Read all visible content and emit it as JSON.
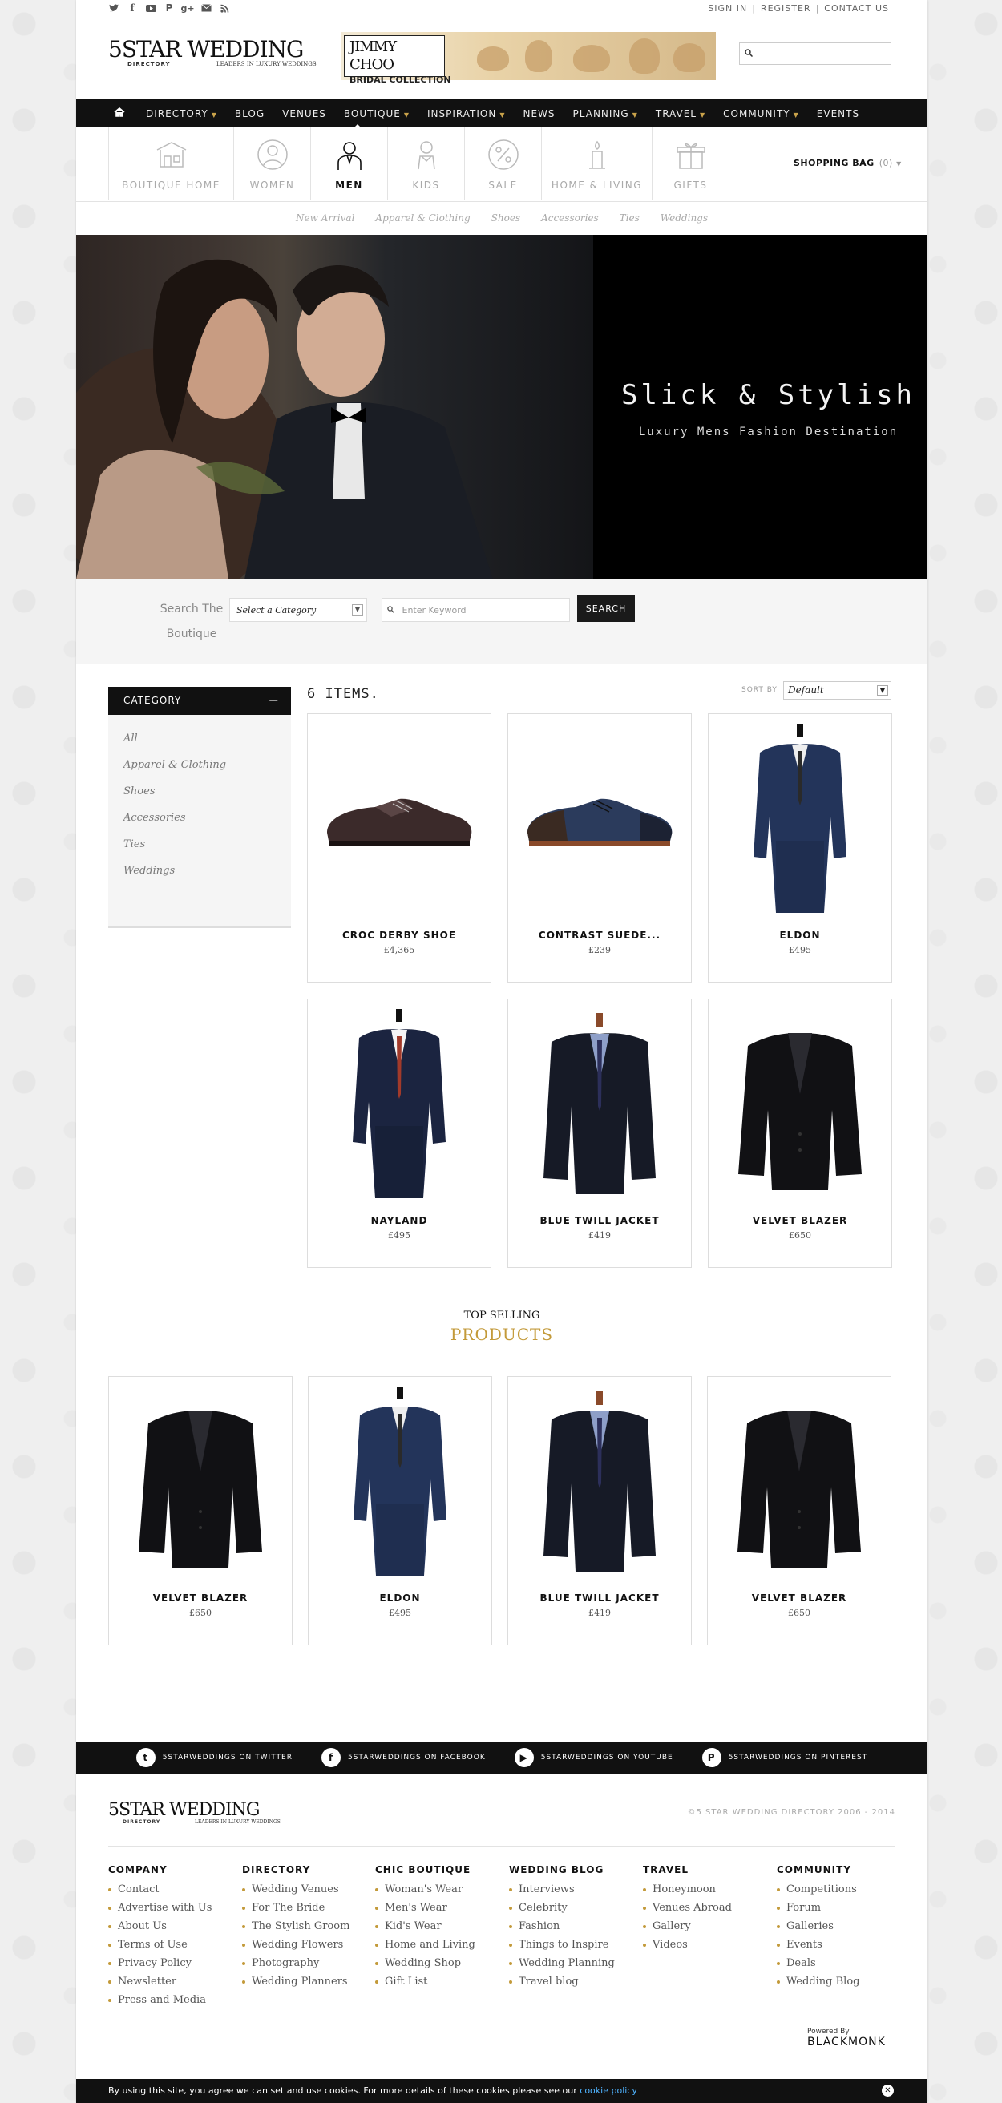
{
  "top": {
    "social_icons": [
      "twitter-icon",
      "facebook-icon",
      "youtube-icon",
      "pinterest-icon",
      "google-plus-icon",
      "email-icon",
      "rss-icon"
    ],
    "links": [
      "SIGN IN",
      "REGISTER",
      "CONTACT US"
    ]
  },
  "logo": {
    "big": "5STAR WEDDING",
    "small": "DIRECTORY",
    "tag": "LEADERS IN LUXURY WEDDINGS"
  },
  "ad": {
    "line1": "JIMMY CHOO",
    "line2": "BRIDAL COLLECTION"
  },
  "nav": {
    "items": [
      {
        "label": "DIRECTORY",
        "caret": true
      },
      {
        "label": "BLOG",
        "caret": false
      },
      {
        "label": "VENUES",
        "caret": false
      },
      {
        "label": "BOUTIQUE",
        "caret": true
      },
      {
        "label": "INSPIRATION",
        "caret": true
      },
      {
        "label": "NEWS",
        "caret": false
      },
      {
        "label": "PLANNING",
        "caret": true
      },
      {
        "label": "TRAVEL",
        "caret": true
      },
      {
        "label": "COMMUNITY",
        "caret": true
      },
      {
        "label": "EVENTS",
        "caret": false
      }
    ]
  },
  "boutique": {
    "cats": [
      "BOUTIQUE HOME",
      "WOMEN",
      "MEN",
      "KIDS",
      "SALE",
      "HOME & LIVING",
      "GIFTS"
    ],
    "bag_label": "SHOPPING BAG",
    "bag_count": "(0)",
    "sublinks": [
      "New Arrival",
      "Apparel & Clothing",
      "Shoes",
      "Accessories",
      "Ties",
      "Weddings"
    ]
  },
  "hero": {
    "title": "Slick & Stylish",
    "subtitle": "Luxury Mens Fashion Destination"
  },
  "search": {
    "label": "Search The Boutique",
    "category": "Select a Category",
    "keyword_placeholder": "Enter Keyword",
    "button": "SEARCH"
  },
  "sidebar": {
    "title": "CATEGORY",
    "items": [
      "All",
      "Apparel & Clothing",
      "Shoes",
      "Accessories",
      "Ties",
      "Weddings"
    ]
  },
  "listing": {
    "count": "6 ITEMS.",
    "sort_label": "SORT BY",
    "sort_value": "Default"
  },
  "products": [
    {
      "name": "CROC DERBY SHOE",
      "price": "£4,365"
    },
    {
      "name": "CONTRAST SUEDE...",
      "price": "£239"
    },
    {
      "name": "ELDON",
      "price": "£495"
    },
    {
      "name": "NAYLAND",
      "price": "£495"
    },
    {
      "name": "BLUE TWILL JACKET",
      "price": "£419"
    },
    {
      "name": "VELVET BLAZER",
      "price": "£650"
    }
  ],
  "top_selling": {
    "line1": "TOP SELLING",
    "line2": "PRODUCTS",
    "items": [
      {
        "name": "VELVET BLAZER",
        "price": "£650"
      },
      {
        "name": "ELDON",
        "price": "£495"
      },
      {
        "name": "BLUE TWILL JACKET",
        "price": "£419"
      },
      {
        "name": "VELVET BLAZER",
        "price": "£650"
      }
    ]
  },
  "social_bar": [
    "5STARWEDDINGS ON TWITTER",
    "5STARWEDDINGS ON FACEBOOK",
    "5STARWEDDINGS ON YOUTUBE",
    "5STARWEDDINGS ON PINTEREST"
  ],
  "footer": {
    "copyright": "©5 STAR WEDDING DIRECTORY 2006 - 2014",
    "columns": [
      {
        "title": "COMPANY",
        "links": [
          "Contact",
          "Advertise with Us",
          "About Us",
          "Terms of Use",
          "Privacy Policy",
          "Newsletter",
          "Press and Media"
        ]
      },
      {
        "title": "DIRECTORY",
        "links": [
          "Wedding Venues",
          "For The Bride",
          "The Stylish Groom",
          "Wedding Flowers",
          "Photography",
          "Wedding Planners"
        ]
      },
      {
        "title": "CHIC BOUTIQUE",
        "links": [
          "Woman's Wear",
          "Men's Wear",
          "Kid's Wear",
          "Home and Living",
          "Wedding Shop",
          "Gift List"
        ]
      },
      {
        "title": "WEDDING BLOG",
        "links": [
          "Interviews",
          "Celebrity",
          "Fashion",
          "Things to Inspire",
          "Wedding Planning",
          "Travel blog"
        ]
      },
      {
        "title": "TRAVEL",
        "links": [
          "Honeymoon",
          "Venues Abroad",
          "Gallery",
          "Videos"
        ]
      },
      {
        "title": "COMMUNITY",
        "links": [
          "Competitions",
          "Forum",
          "Galleries",
          "Events",
          "Deals",
          "Wedding Blog"
        ]
      }
    ],
    "powered_by": "Powered By",
    "powered_brand": "BLACKMONK"
  },
  "cookie": {
    "text": "By using this site, you agree we can set and use cookies. For more details of these cookies please see our",
    "link": "cookie policy"
  },
  "colors": {
    "accent": "#c39a3a",
    "nav_bg": "#111111",
    "link_blue": "#4fb3ff"
  }
}
